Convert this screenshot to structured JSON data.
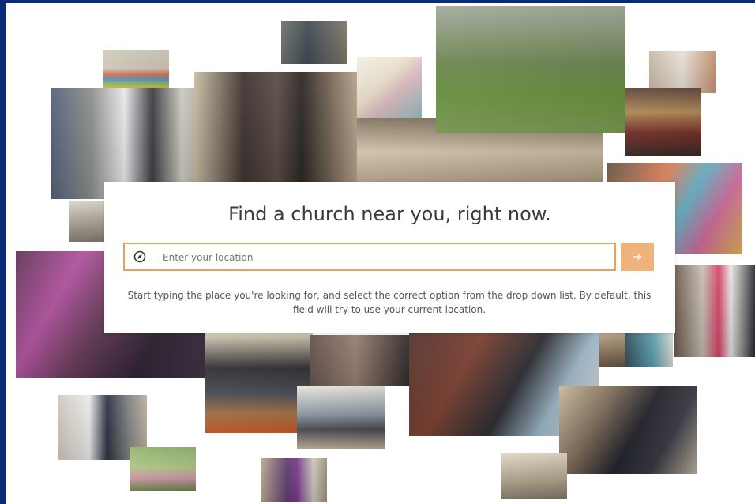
{
  "search": {
    "headline": "Find a church near you, right now.",
    "placeholder": "Enter your location",
    "helper_text": "Start typing the place you're looking for, and select the correct option from the drop down list. By default, this field will try to use your current location.",
    "icon": "compass-icon",
    "submit_icon": "arrow-right-icon",
    "accent_color": "#e6a25a",
    "button_color": "#f0b27c"
  },
  "colors": {
    "outer_background": "#0d2a78",
    "page_background": "#ffffff"
  }
}
